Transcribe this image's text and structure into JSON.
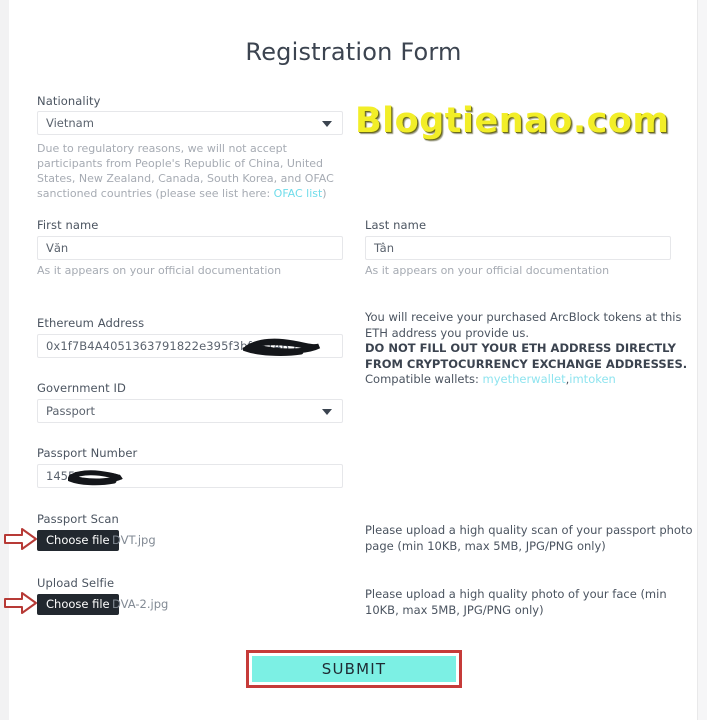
{
  "page": {
    "title": "Registration Form",
    "watermark": "Blogtienao.com"
  },
  "nationality": {
    "label": "Nationality",
    "value": "Vietnam",
    "notice_part1": "Due to regulatory reasons, we will not accept participants from People's Republic of China, United States, New Zealand, Canada, South Korea, and OFAC sanctioned countries (please see list here: ",
    "notice_link": "OFAC list",
    "notice_part2": ")"
  },
  "first_name": {
    "label": "First name",
    "value": "Văn",
    "helper": "As it appears on your official documentation"
  },
  "last_name": {
    "label": "Last name",
    "value": "Tân",
    "helper": "As it appears on your official documentation"
  },
  "eth_address": {
    "label": "Ethereum Address",
    "value": "0x1f7B4A4051363791822e395f3bfd314B5",
    "note_line1": "You will receive your purchased ArcBlock tokens at this ETH address you provide us.",
    "note_line2": "DO NOT FILL OUT YOUR ETH ADDRESS DIRECTLY FROM CRYPTOCURRENCY EXCHANGE ADDRESSES.",
    "note_line3_prefix": "Compatible wallets: ",
    "wallet_link_1": "myetherwallet",
    "wallet_separator": ",",
    "wallet_link_2": "imtoken"
  },
  "government_id": {
    "label": "Government ID",
    "value": "Passport"
  },
  "passport_number": {
    "label": "Passport Number",
    "value": "1455"
  },
  "passport_scan": {
    "label": "Passport Scan",
    "button": "Choose file",
    "filename": "DVT.jpg",
    "instructions": "Please upload a high quality scan of your passport photo page (min 10KB, max 5MB, JPG/PNG only)"
  },
  "upload_selfie": {
    "label": "Upload Selfie",
    "button": "Choose file",
    "filename": "DVA-2.jpg",
    "instructions": "Please upload a high quality photo of your face (min 10KB, max 5MB, JPG/PNG only)"
  },
  "submit": {
    "label": "SUBMIT"
  },
  "colors": {
    "accent_cyan": "#7cf0e4",
    "annotation_red": "#c63b39",
    "link_cyan": "#6fdcea",
    "watermark_yellow": "#f2ee28",
    "chooser_dark": "#22282f"
  }
}
